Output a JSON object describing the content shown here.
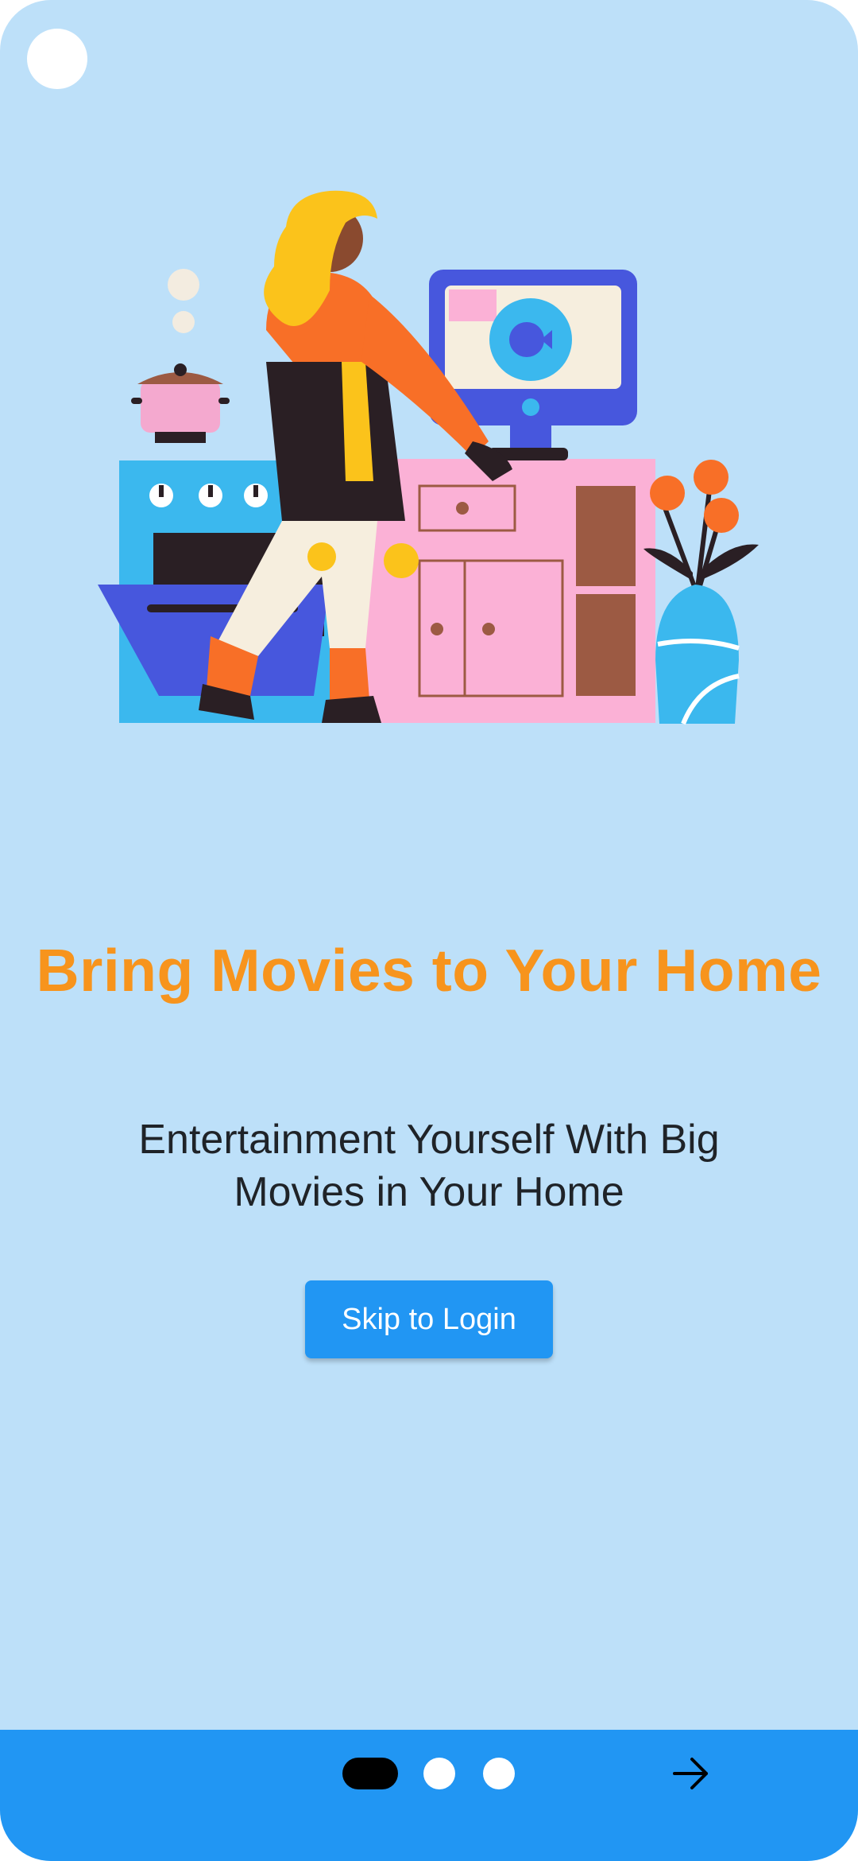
{
  "onboarding": {
    "headline": "Bring Movies to Your Home",
    "subtitle": "Entertainment Yourself With Big Movies in Your Home",
    "skip_label": "Skip to Login",
    "page_count": 3,
    "current_page": 1
  },
  "colors": {
    "background": "#bde0f9",
    "accent": "#2196f3",
    "headline": "#f7941d",
    "active_indicator": "#000000",
    "inactive_indicator": "#ffffff"
  },
  "icons": {
    "next": "arrow-right-icon",
    "illustration": "woman-cooking-kitchen-illustration"
  }
}
